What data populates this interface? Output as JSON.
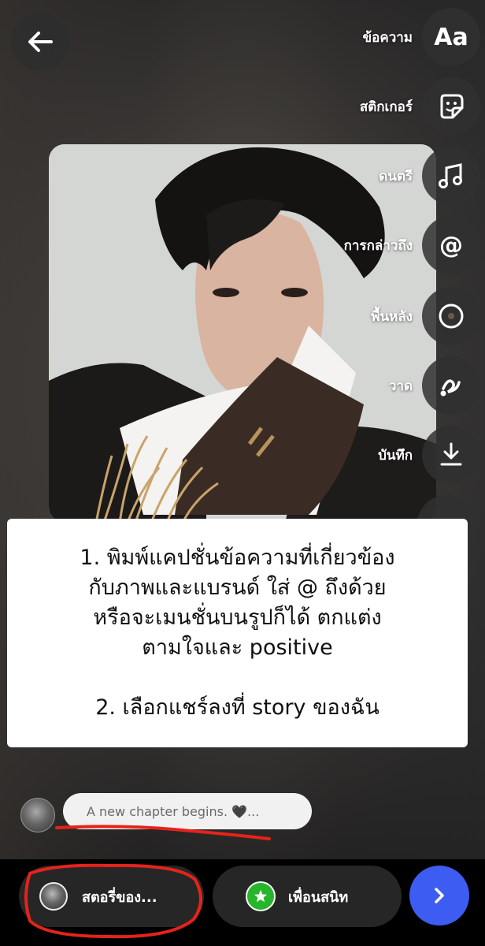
{
  "toolbar": {
    "tools": [
      {
        "label": "ข้อความ",
        "icon": "text-icon",
        "glyph": "Aa"
      },
      {
        "label": "สติกเกอร์",
        "icon": "sticker-icon"
      },
      {
        "label": "ดนตรี",
        "icon": "music-icon"
      },
      {
        "label": "การกล่าวถึง",
        "icon": "mention-icon",
        "glyph": "@"
      },
      {
        "label": "พื้นหลัง",
        "icon": "background-icon"
      },
      {
        "label": "วาด",
        "icon": "draw-icon"
      },
      {
        "label": "บันทึก",
        "icon": "download-icon"
      }
    ]
  },
  "instructions": {
    "line1": "1. พิมพ์แคปชั่นข้อความที่เกี่ยวข้อง",
    "line2": "กับภาพและแบรนด์ ใส่ @ ถึงด้วย",
    "line3": "หรือจะเมนชั่นบนรูปก็ได้ ตกแต่ง",
    "line4": "ตามใจและ positive",
    "line5": "2. เลือกแชร์ลงที่ story ของฉัน"
  },
  "caption": {
    "text": "A new chapter begins. 🖤..."
  },
  "bottom": {
    "story_label": "สตอรี่ของ...",
    "close_friends_label": "เพื่อนสนิท"
  },
  "colors": {
    "send_button": "#3c5cf2",
    "close_friends": "#27b52b",
    "annotation_red": "#e5231b"
  }
}
